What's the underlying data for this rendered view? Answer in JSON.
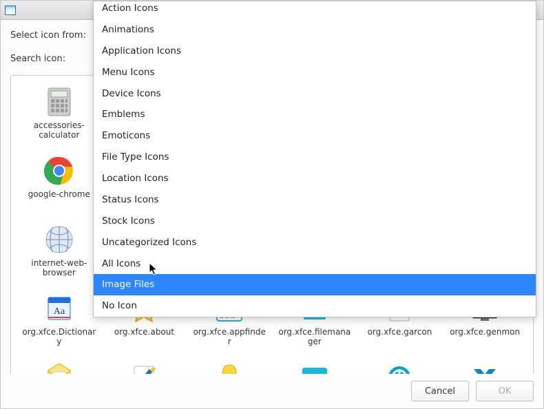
{
  "labels": {
    "select_from": "Select icon from:",
    "search_icon": "Search icon:"
  },
  "buttons": {
    "cancel": "Cancel",
    "ok": "OK"
  },
  "menu": {
    "items": [
      "Action Icons",
      "Animations",
      "Application Icons",
      "Menu Icons",
      "Device Icons",
      "Emblems",
      "Emoticons",
      "File Type Icons",
      "Location Icons",
      "Status Icons",
      "Stock Icons",
      "Uncategorized Icons",
      "All Icons",
      "Image Files",
      "No Icon"
    ],
    "cut_first": true,
    "selected_index": 13
  },
  "icons": [
    {
      "id": "accessories-calculator",
      "label": "accessories-calculator",
      "glyph": "calculator"
    },
    {
      "id": "hidden-1",
      "label": "",
      "glyph": "none"
    },
    {
      "id": "hidden-2",
      "label": "",
      "glyph": "none"
    },
    {
      "id": "hidden-3",
      "label": "",
      "glyph": "none"
    },
    {
      "id": "hidden-4",
      "label": "",
      "glyph": "none"
    },
    {
      "id": "hidden-5",
      "label": "",
      "glyph": "none"
    },
    {
      "id": "google-chrome",
      "label": "google-chrome",
      "glyph": "chrome"
    },
    {
      "id": "hidden-6",
      "label": "",
      "glyph": "none"
    },
    {
      "id": "hidden-7",
      "label": "",
      "glyph": "none"
    },
    {
      "id": "hidden-8",
      "label": "",
      "glyph": "none"
    },
    {
      "id": "hidden-9",
      "label": "",
      "glyph": "none"
    },
    {
      "id": "hidden-10",
      "label": "",
      "glyph": "none"
    },
    {
      "id": "internet-web-browser",
      "label": "internet-web-browser",
      "glyph": "globe"
    },
    {
      "id": "hidden-11",
      "label": "",
      "glyph": "none"
    },
    {
      "id": "hidden-12",
      "label": "",
      "glyph": "none"
    },
    {
      "id": "hidden-13",
      "label": "",
      "glyph": "none"
    },
    {
      "id": "hidden-14",
      "label": "",
      "glyph": "none"
    },
    {
      "id": "hidden-15",
      "label": "",
      "glyph": "none"
    },
    {
      "id": "org-xfce-dictionary",
      "label": "org.xfce.Dictionary",
      "glyph": "dictionary"
    },
    {
      "id": "org-xfce-about",
      "label": "org.xfce.about",
      "glyph": "star"
    },
    {
      "id": "org-xfce-appfinder",
      "label": "org.xfce.appfinder",
      "glyph": "appfinder"
    },
    {
      "id": "org-xfce-filemanager",
      "label": "org.xfce.filemanager",
      "glyph": "filemanager"
    },
    {
      "id": "org-xfce-garcon",
      "label": "org.xfce.garcon",
      "glyph": "garcon"
    },
    {
      "id": "org-xfce-genmon",
      "label": "org.xfce.genmon",
      "glyph": "genmon"
    },
    {
      "id": "mail",
      "label": "",
      "glyph": "mail"
    },
    {
      "id": "notes",
      "label": "",
      "glyph": "notes"
    },
    {
      "id": "bell",
      "label": "",
      "glyph": "bell"
    },
    {
      "id": "panel",
      "label": "",
      "glyph": "panel"
    },
    {
      "id": "power",
      "label": "",
      "glyph": "power"
    },
    {
      "id": "xfce-x",
      "label": "",
      "glyph": "xfce-x"
    }
  ],
  "colors": {
    "accent": "#2e86ff",
    "cyan": "#1bb8d8",
    "yellow": "#ffd33a",
    "green": "#1aab1a"
  }
}
